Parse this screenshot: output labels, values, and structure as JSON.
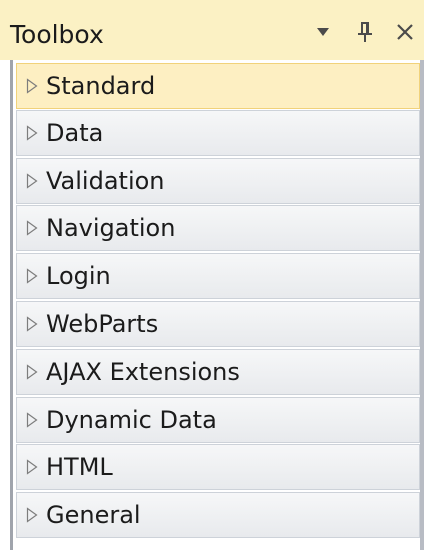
{
  "window": {
    "title": "Toolbox",
    "buttons": {
      "dropdown_icon": "triangle-down",
      "pin_icon": "pushpin",
      "close_icon": "close-x"
    }
  },
  "toolbox": {
    "selected_index": 0,
    "colors": {
      "title_bg": "#fbf1c4",
      "selected_bg": "#fdefc2",
      "item_bg": "#eceef1",
      "item_border": "#cdd2d9"
    },
    "groups": [
      {
        "label": "Standard"
      },
      {
        "label": "Data"
      },
      {
        "label": "Validation"
      },
      {
        "label": "Navigation"
      },
      {
        "label": "Login"
      },
      {
        "label": "WebParts"
      },
      {
        "label": "AJAX Extensions"
      },
      {
        "label": "Dynamic Data"
      },
      {
        "label": "HTML"
      },
      {
        "label": "General"
      }
    ]
  }
}
